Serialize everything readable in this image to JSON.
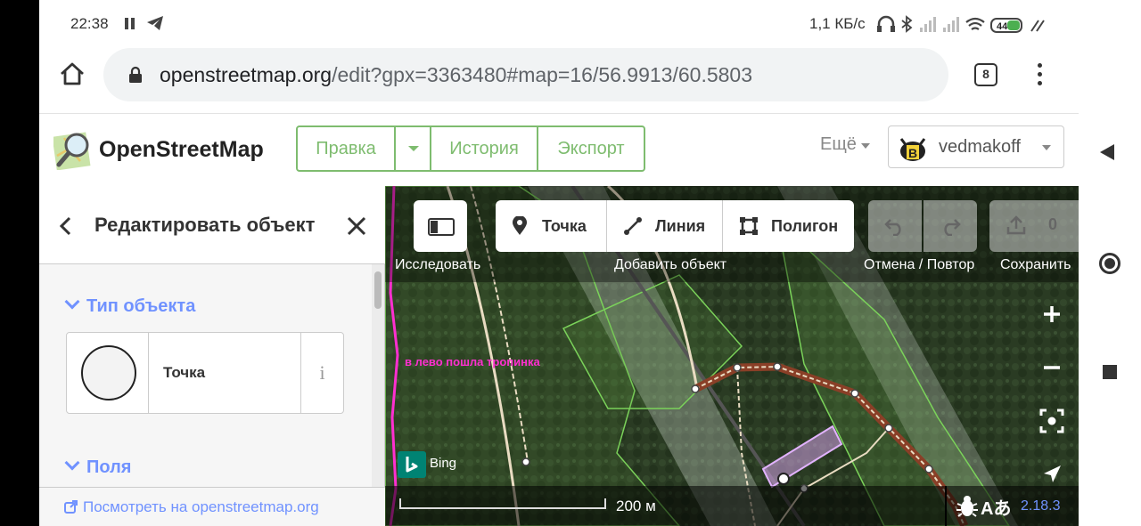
{
  "status": {
    "time": "22:38",
    "speed": "1,1 КБ/с",
    "battery": "44"
  },
  "browser": {
    "url_host": "openstreetmap.org",
    "url_path": "/edit?gpx=3363480#map=16/56.9913/60.5803",
    "tab_count": "8"
  },
  "osm": {
    "brand": "OpenStreetMap",
    "edit_label": "Правка",
    "history_label": "История",
    "export_label": "Экспорт",
    "more_label": "Ещё",
    "username": "vedmakoff",
    "accent": "#7ebc6f"
  },
  "panel": {
    "title": "Редактировать объект",
    "type_section": "Тип объекта",
    "preset_name": "Точка",
    "info_label": "i",
    "fields_section": "Поля",
    "view_link": "Посмотреть на openstreetmap.org",
    "link_color": "#7092ff"
  },
  "map": {
    "explore_label": "Исследовать",
    "point_label": "Точка",
    "line_label": "Линия",
    "polygon_label": "Полигон",
    "add_label": "Добавить объект",
    "undo_redo_label": "Отмена / Повтор",
    "save_label": "Сохранить",
    "save_count": "0",
    "track_label": "в лево пошла тропинка",
    "imagery": "Bing",
    "scale_text": "200 м",
    "version": "2.18.3"
  }
}
